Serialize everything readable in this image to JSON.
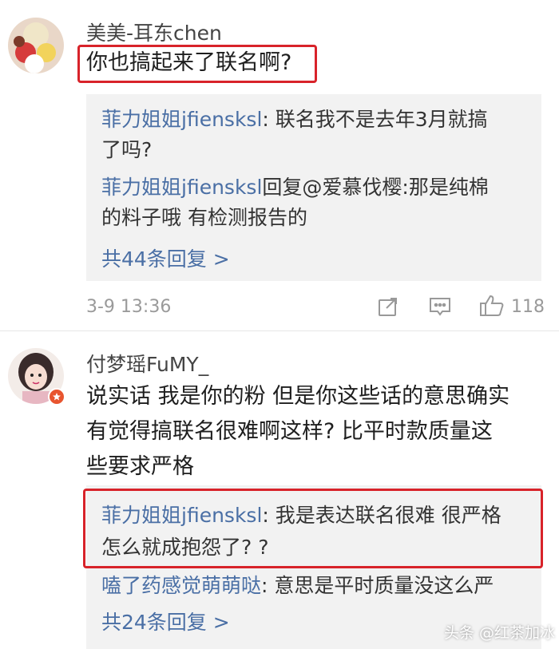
{
  "comment1": {
    "username": "美美-耳东chen",
    "text": "你也搞起来了联名啊?",
    "replies": [
      {
        "name": "菲力姐姐jfiensksl",
        "line1": ": 联名我不是去年3月就搞",
        "line2": "了吗?"
      },
      {
        "name": "菲力姐姐jfiensksl",
        "line1": "回复@爱慕伐樱:那是纯棉",
        "line2": "的料子哦 有检测报告的"
      }
    ],
    "more": "共44条回复 >",
    "time": "3-9 13:36",
    "likes": "118"
  },
  "comment2": {
    "username": "付梦瑶FuMY_",
    "text_lines": [
      "说实话 我是你的粉 但是你这些话的意思确实",
      "有觉得搞联名很难啊这样? 比平时款质量这",
      "些要求严格"
    ],
    "replies": [
      {
        "name": "菲力姐姐jfiensksl",
        "line1": ": 我是表达联名很难 很严格",
        "line2": "怎么就成抱怨了? ?"
      },
      {
        "name": "嗑了药感觉萌萌哒",
        "line1": ": 意思是平时质量没这么严"
      }
    ],
    "more": "共24条回复 >"
  },
  "watermark": "头条 @红茶加冰",
  "colors": {
    "link": "#4a6fa5",
    "highlight": "#d8232a",
    "reply_bg": "#f2f2f2"
  }
}
